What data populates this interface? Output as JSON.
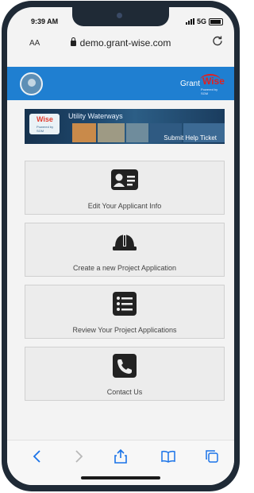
{
  "status_bar": {
    "time": "9:39 AM",
    "network": "5G"
  },
  "browser": {
    "aa_label": "AA",
    "url": "demo.grant-wise.com"
  },
  "header": {
    "logo_grant": "Grant",
    "logo_wise": "Wise",
    "logo_powered": "Powered by SGM"
  },
  "banner": {
    "logo_text": "Wise",
    "logo_sub": "Powered by SGM",
    "title": "Utility Waterways",
    "submit_link": "Submit Help Ticket"
  },
  "menu": [
    {
      "label": "Edit Your Applicant Info",
      "icon": "id-card-icon"
    },
    {
      "label": "Create a new Project Application",
      "icon": "hard-hat-icon"
    },
    {
      "label": "Review Your Project Applications",
      "icon": "list-icon"
    },
    {
      "label": "Contact Us",
      "icon": "phone-icon"
    }
  ],
  "colors": {
    "header_blue": "#1f7fd1",
    "card_bg": "#ececec",
    "icon_dark": "#222222",
    "safari_blue": "#1a73e8"
  }
}
